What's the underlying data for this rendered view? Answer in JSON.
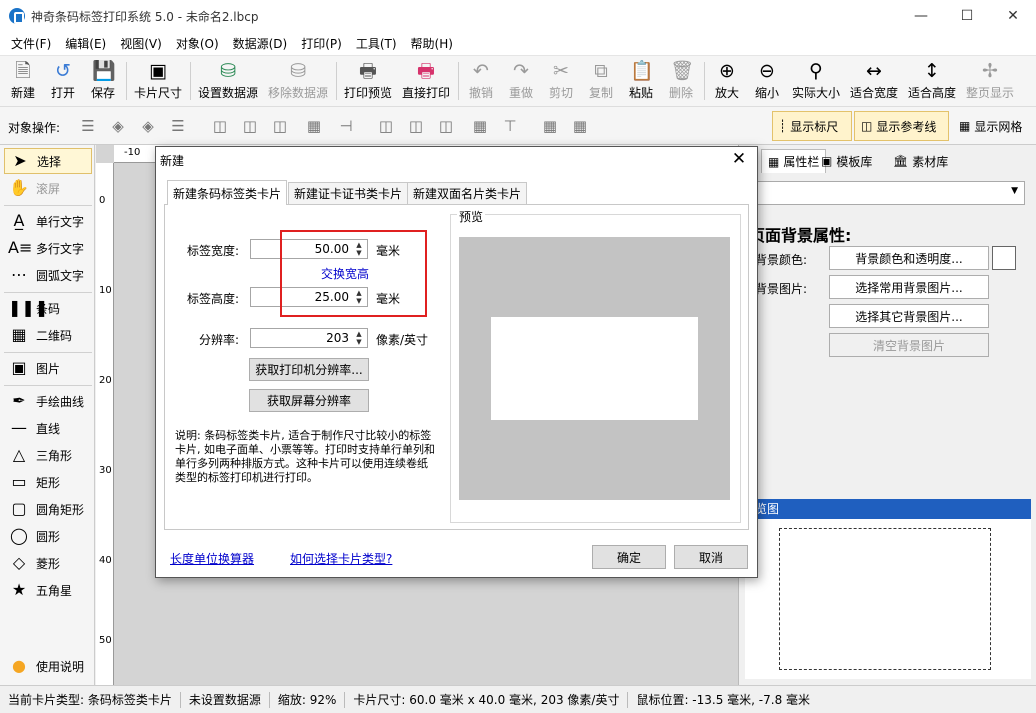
{
  "window": {
    "title": "神奇条码标签打印系统 5.0 - 未命名2.lbcp"
  },
  "menu": [
    "文件(F)",
    "编辑(E)",
    "视图(V)",
    "对象(O)",
    "数据源(D)",
    "打印(P)",
    "工具(T)",
    "帮助(H)"
  ],
  "toolbar": {
    "new": "新建",
    "open": "打开",
    "save": "保存",
    "card_size": "卡片尺寸",
    "set_datasource": "设置数据源",
    "remove_datasource": "移除数据源",
    "print_preview": "打印预览",
    "direct_print": "直接打印",
    "undo": "撤销",
    "redo": "重做",
    "cut": "剪切",
    "copy": "复制",
    "paste": "粘贴",
    "delete": "删除",
    "zoom_in": "放大",
    "zoom_out": "缩小",
    "actual_size": "实际大小",
    "fit_width": "适合宽度",
    "fit_height": "适合高度",
    "full_page": "整页显示"
  },
  "objbar": {
    "label": "对象操作:",
    "show_ruler": "显示标尺",
    "show_guides": "显示参考线",
    "show_grid": "显示网格"
  },
  "tools": [
    "选择",
    "滚屏",
    "单行文字",
    "多行文字",
    "圆弧文字",
    "条码",
    "二维码",
    "图片",
    "手绘曲线",
    "直线",
    "三角形",
    "矩形",
    "圆角矩形",
    "圆形",
    "菱形",
    "五角星",
    "使用说明"
  ],
  "ruler": {
    "h_label": "-10",
    "v_labels": [
      "0",
      "10",
      "20",
      "30",
      "40",
      "50"
    ]
  },
  "rightpanel": {
    "tabs": [
      "属性栏",
      "模板库",
      "素材库"
    ],
    "heading": "页面背景属性:",
    "bg_color_label": "背景颜色:",
    "bg_image_label": "背景图片:",
    "btn_bg_color": "背景颜色和透明度...",
    "btn_common_image": "选择常用背景图片...",
    "btn_other_image": "选择其它背景图片...",
    "btn_clear_image": "清空背景图片",
    "overview_title": "览图"
  },
  "dialog": {
    "title": "新建",
    "tabs": [
      "新建条码标签类卡片",
      "新建证卡证书类卡片",
      "新建双面名片类卡片"
    ],
    "width_label": "标签宽度:",
    "width_value": "50.00",
    "width_unit": "毫米",
    "swap": "交换宽高",
    "height_label": "标签高度:",
    "height_value": "25.00",
    "height_unit": "毫米",
    "dpi_label": "分辨率:",
    "dpi_value": "203",
    "dpi_unit": "像素/英寸",
    "btn_printer_dpi": "获取打印机分辨率...",
    "btn_screen_dpi": "获取屏幕分辨率",
    "description": "说明: 条码标签类卡片, 适合于制作尺寸比较小的标签卡片, 如电子面单、小票等等。打印时支持单行单列和单行多列两种排版方式。这种卡片可以使用连续卷纸类型的标签打印机进行打印。",
    "preview_label": "预览",
    "link_converter": "长度单位换算器",
    "link_howto": "如何选择卡片类型?",
    "ok": "确定",
    "cancel": "取消"
  },
  "status": {
    "card_type": "当前卡片类型: 条码标签类卡片",
    "datasource": "未设置数据源",
    "zoom": "缩放: 92%",
    "card_size": "卡片尺寸: 60.0 毫米 x 40.0 毫米, 203 像素/英寸",
    "mouse_pos": "鼠标位置: -13.5 毫米, -7.8 毫米"
  }
}
